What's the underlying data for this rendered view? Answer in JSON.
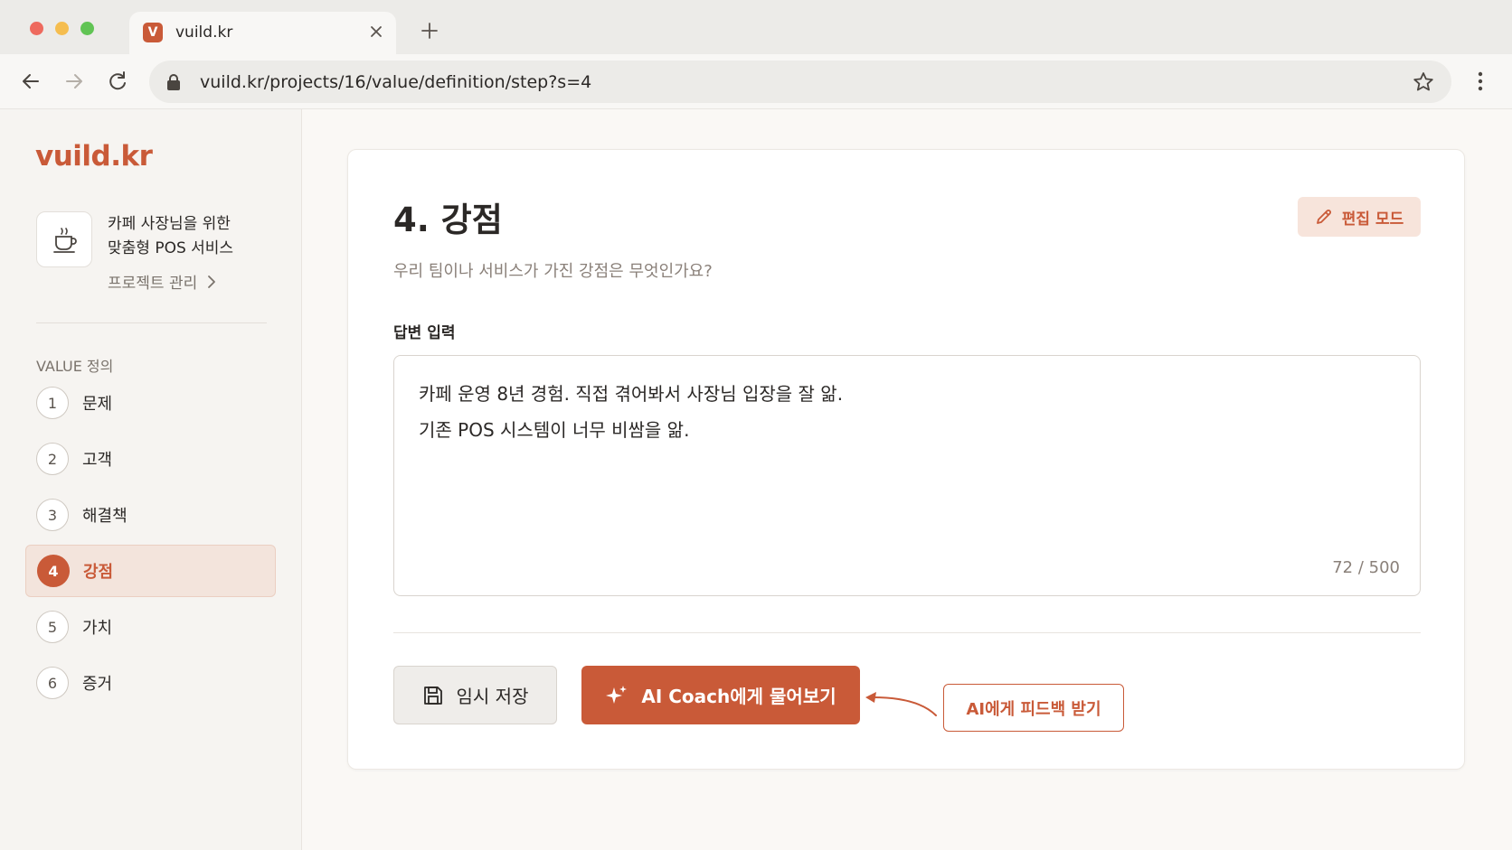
{
  "browser": {
    "tab_title": "vuild.kr",
    "tab_favicon_letter": "V",
    "url": "vuild.kr/projects/16/value/definition/step?s=4"
  },
  "sidebar": {
    "logo": "vuild.kr",
    "project": {
      "icon": "coffee-cup-icon",
      "name_line1": "카페 사장님을 위한",
      "name_line2": "맞춤형 POS 서비스",
      "manage_label": "프로젝트 관리"
    },
    "section_label": "VALUE 정의",
    "steps": [
      {
        "num": "1",
        "label": "문제"
      },
      {
        "num": "2",
        "label": "고객"
      },
      {
        "num": "3",
        "label": "해결책"
      },
      {
        "num": "4",
        "label": "강점"
      },
      {
        "num": "5",
        "label": "가치"
      },
      {
        "num": "6",
        "label": "증거"
      }
    ],
    "active_step": 4
  },
  "main": {
    "title": "4. 강점",
    "edit_button": "편집 모드",
    "subtitle": "우리 팀이나 서비스가 가진 강점은 무엇인가요?",
    "answer_label": "답변 입력",
    "answer_lines": [
      "카페 운영 8년 경험. 직접 겪어봐서 사장님 입장을 잘 앎.",
      "기존 POS 시스템이 너무 비쌈을 앎."
    ],
    "char_count": "72 / 500",
    "save_button": "임시 저장",
    "ai_button": "AI Coach에게 물어보기",
    "callout": "AI에게 피드백 받기"
  },
  "colors": {
    "accent": "#c95a38",
    "accent_light": "#f7e4db",
    "sidebar_bg": "#f6f4f1"
  }
}
